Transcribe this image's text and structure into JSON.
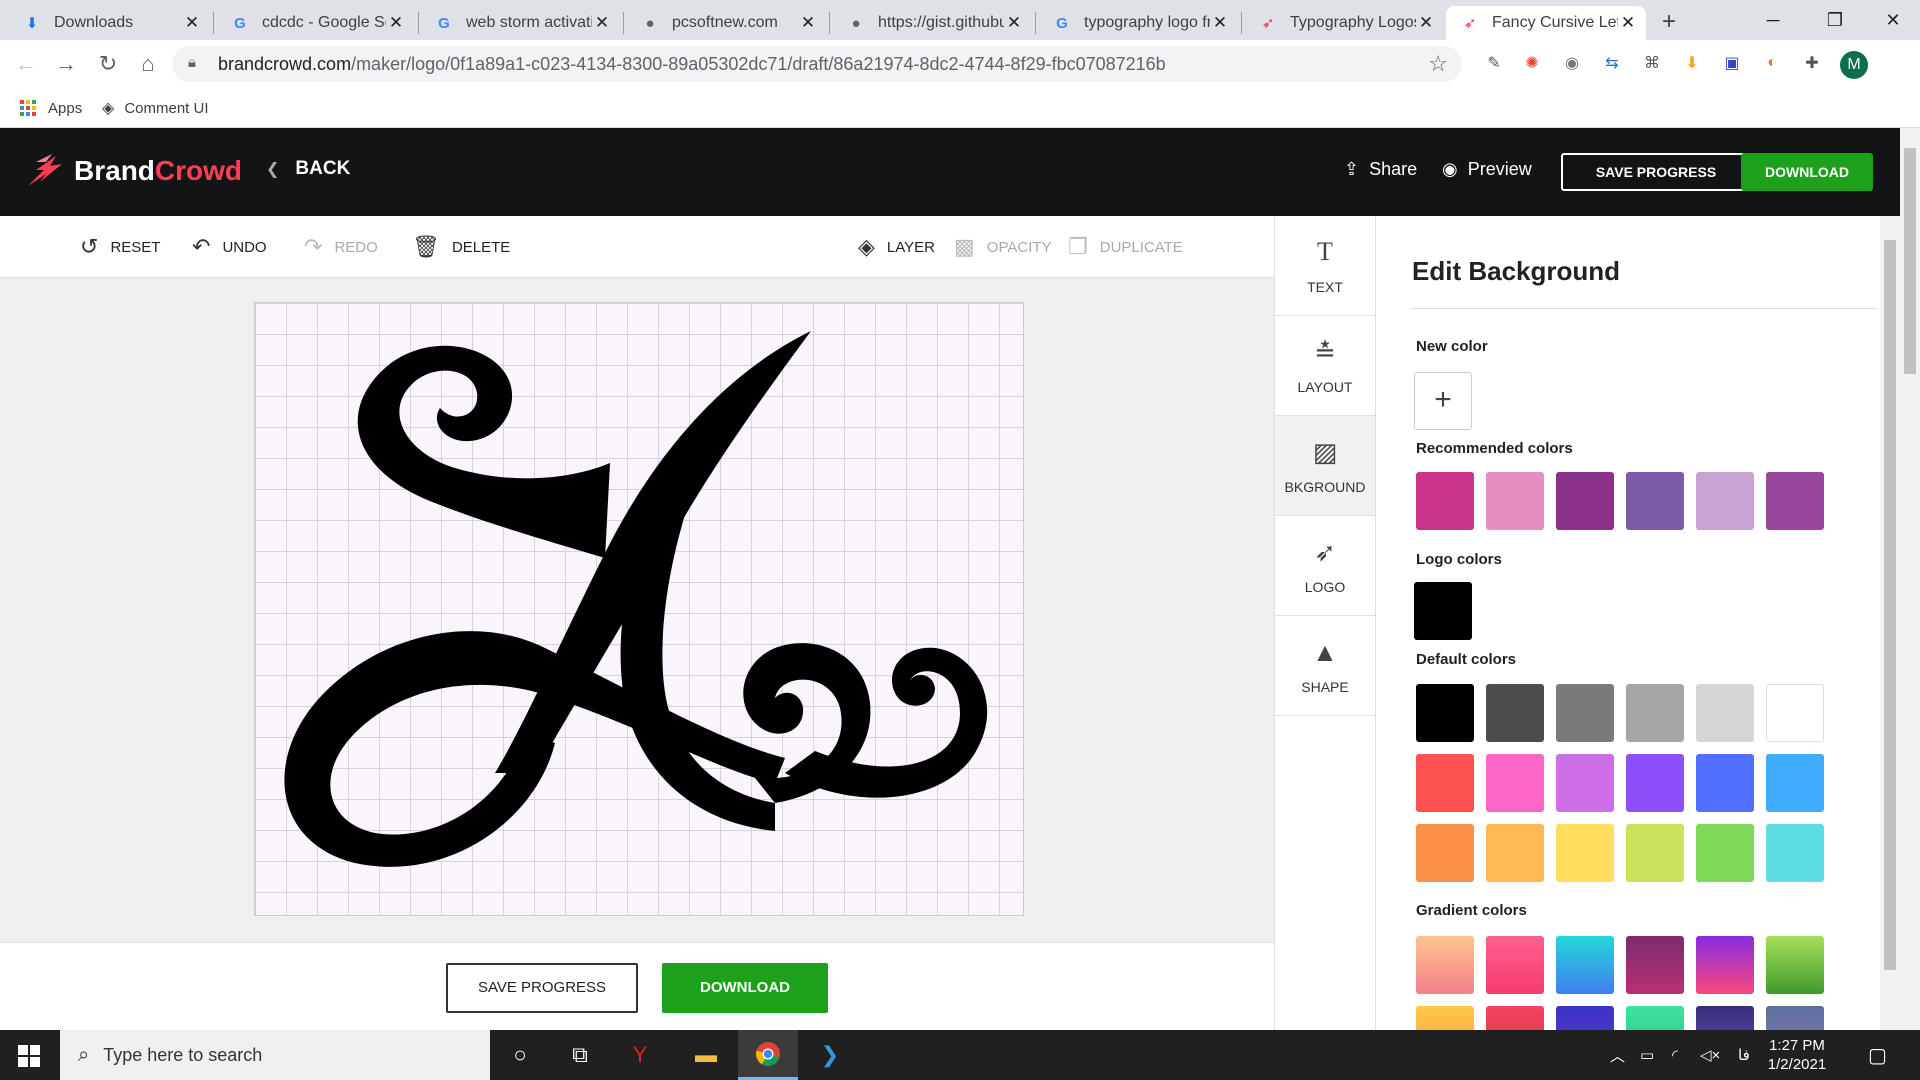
{
  "browser": {
    "tabs": [
      {
        "title": "Downloads",
        "icon": "download-icon"
      },
      {
        "title": "cdcdc - Google Se",
        "icon": "google-icon"
      },
      {
        "title": "web storm activati",
        "icon": "google-icon"
      },
      {
        "title": "pcsoftnew.com",
        "icon": "globe-icon"
      },
      {
        "title": "https://gist.githubu",
        "icon": "globe-icon"
      },
      {
        "title": "typography logo fr",
        "icon": "google-icon"
      },
      {
        "title": "Typography Logos",
        "icon": "brandcrowd-icon"
      },
      {
        "title": "Fancy Cursive Lette",
        "icon": "brandcrowd-icon"
      }
    ],
    "url_host": "brandcrowd.com",
    "url_path": "/maker/logo/0f1a89a1-c023-4134-8300-89a05302dc71/draft/86a21974-8dc2-4744-8f29-fbc07087216b",
    "profile_initial": "M",
    "bookmarks": [
      {
        "label": "Apps"
      },
      {
        "label": "Comment UI"
      }
    ]
  },
  "header": {
    "brand_part1": "Brand",
    "brand_part2": "Crowd",
    "back_label": "BACK",
    "share_label": "Share",
    "preview_label": "Preview",
    "save_label": "SAVE PROGRESS",
    "download_label": "DOWNLOAD",
    "brand_color": "#ff3e55",
    "download_color": "#1da11a"
  },
  "toolbar": {
    "reset": "RESET",
    "undo": "UNDO",
    "redo": "REDO",
    "delete": "DELETE",
    "layer": "LAYER",
    "opacity": "OPACITY",
    "duplicate": "DUPLICATE"
  },
  "bottom": {
    "save_label": "SAVE PROGRESS",
    "download_label": "DOWNLOAD"
  },
  "side_tabs": [
    {
      "label": "TEXT",
      "icon": "text-icon"
    },
    {
      "label": "LAYOUT",
      "icon": "layout-icon"
    },
    {
      "label": "BKGROUND",
      "icon": "background-icon",
      "active": true
    },
    {
      "label": "LOGO",
      "icon": "logo-icon"
    },
    {
      "label": "SHAPE",
      "icon": "shape-icon"
    }
  ],
  "panel": {
    "title": "Edit Background",
    "new_color_label": "New color",
    "recommended_label": "Recommended colors",
    "recommended": [
      "#c9348a",
      "#e48fbe",
      "#8a3289",
      "#7b5ba8",
      "#c6a3d2",
      "#9a449c"
    ],
    "logo_colors_label": "Logo colors",
    "logo_colors": [
      "#000000"
    ],
    "default_label": "Default colors",
    "default_colors": [
      [
        "#000000",
        "#4d4d4d",
        "#7a7a7a",
        "#a6a6a6",
        "#d6d6d6",
        "#ffffff"
      ],
      [
        "#fd5050",
        "#fe66c6",
        "#cd6ee6",
        "#8d4ffa",
        "#5170fd",
        "#3fadfb"
      ],
      [
        "#fe914a",
        "#feb952",
        "#fede5b",
        "#c8e35b",
        "#7fd858",
        "#5ddde1"
      ]
    ],
    "gradient_label": "Gradient colors"
  },
  "taskbar": {
    "search_placeholder": "Type here to search",
    "time": "1:27 PM",
    "date": "1/2/2021",
    "lang": "فا"
  }
}
